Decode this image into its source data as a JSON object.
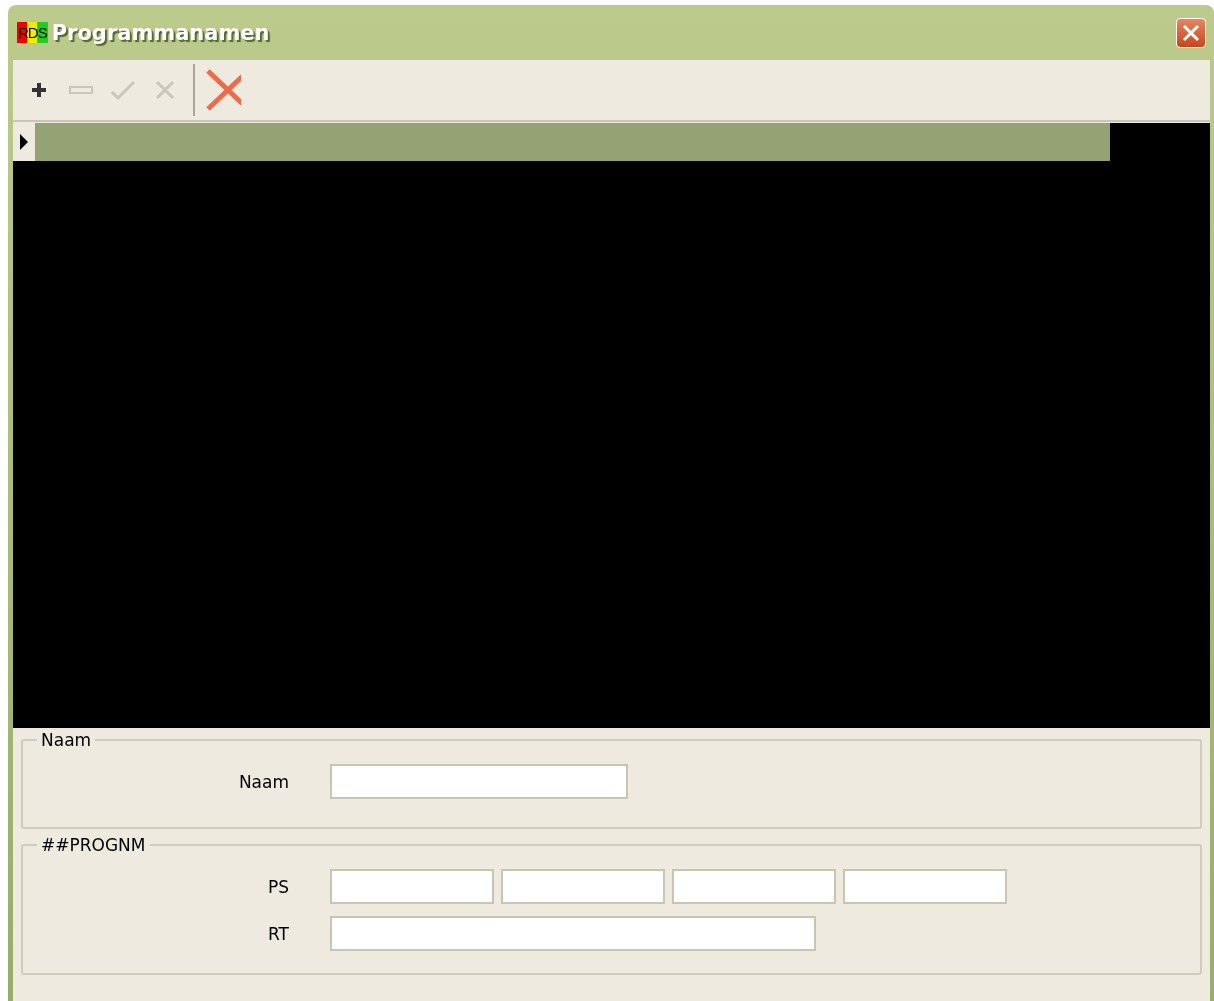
{
  "window": {
    "logo": "RDS",
    "title": "Programmanamen"
  },
  "toolbar": [
    {
      "kind": "add",
      "disabled": false
    },
    {
      "kind": "remove",
      "disabled": true
    },
    {
      "kind": "confirm",
      "disabled": true
    },
    {
      "kind": "cancel",
      "disabled": true
    },
    {
      "kind": "close",
      "disabled": false
    }
  ],
  "grid": {
    "rows": [
      {
        "selected": true
      }
    ]
  },
  "groups": [
    {
      "title": "Naam",
      "rows": [
        {
          "label": "Naam",
          "kind": "medium"
        }
      ]
    },
    {
      "title": "##PROGNM",
      "rows": [
        {
          "label": "PS",
          "kind": "quad"
        },
        {
          "label": "RT",
          "kind": "wide"
        }
      ]
    }
  ]
}
